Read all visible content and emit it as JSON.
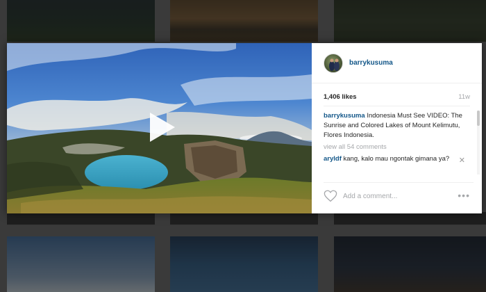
{
  "post": {
    "username": "barrykusuma",
    "likes": "1,406 likes",
    "age": "11w",
    "caption": {
      "author": "barrykusuma",
      "text": "Indonesia Must See VIDEO: The Sunrise and Colored Lakes of Mount Kelimutu, Flores Indonesia."
    },
    "view_all_comments": "view all 54 comments",
    "comments": [
      {
        "author": "aryldf",
        "text": "kang, kalo mau ngontak gimana ya?"
      }
    ],
    "comment_placeholder": "Add a comment...",
    "more_label": "•••",
    "remove_label": "✕"
  },
  "icons": {
    "play": "play-icon",
    "like": "heart-icon",
    "options": "more-options-icon",
    "remove": "close-icon"
  },
  "colors": {
    "link": "#125688",
    "muted": "#a5a7aa",
    "text": "#262626"
  }
}
